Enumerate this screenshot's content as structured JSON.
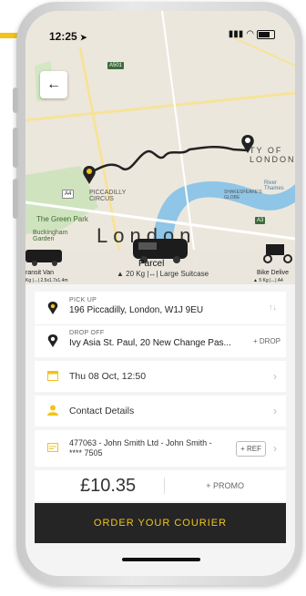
{
  "status": {
    "time": "12:25",
    "location_arrow": "➤"
  },
  "nav": {
    "back_icon": "←"
  },
  "map": {
    "labels": {
      "a501": "A501",
      "picadilly_circus": "PICCADILLY\nCIRCUS",
      "a4": "A4",
      "green_park": "The Green Park",
      "buckingham": "Buckingham\nGarden",
      "city_of_london": "TY OF\nLONDON",
      "shakespeares_globe": "SHAKESPEARE'S\nGLOBE",
      "river": "River Thames",
      "a3": "A3",
      "london_big": "London"
    }
  },
  "vehicles": {
    "left": {
      "name": "ransit Van",
      "capacity": "Kg |↔| 2.5x1.7x1.4m"
    },
    "selected": {
      "name": "Parcel",
      "capacity": "20 Kg |↔| Large Suitcase",
      "icon": "▲"
    },
    "right": {
      "name": "Bike Delive",
      "capacity": "▲ 5 Kg |↔| A4"
    }
  },
  "pickup": {
    "label": "PICK UP",
    "address": "196 Piccadilly, London, W1J 9EU",
    "swap_icon": "↑↓"
  },
  "dropoff": {
    "label": "DROP OFF",
    "address": "Ivy Asia St. Paul, 20 New Change Pas...",
    "add_drop": "+ DROP"
  },
  "date": {
    "value": "Thu 08 Oct, 12:50"
  },
  "contact": {
    "value": "Contact Details"
  },
  "account": {
    "value": "477063 - John Smith Ltd - John Smith - **** 7505",
    "ref_label": "+ REF"
  },
  "price": {
    "value": "£10.35",
    "promo_label": "+ PROMO"
  },
  "order": {
    "label": "ORDER YOUR COURIER"
  },
  "chevron": "›",
  "colors": {
    "accent": "#f3c316",
    "button_bg": "#252525",
    "button_text": "#f1c41b"
  }
}
